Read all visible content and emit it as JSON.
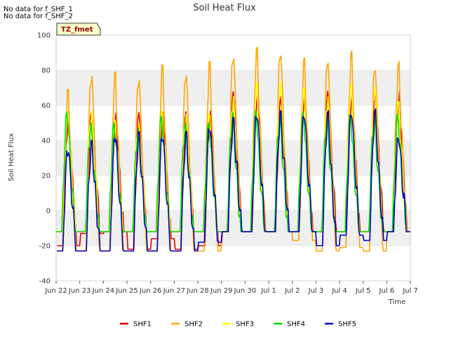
{
  "notes": [
    "No data for f_SHF_1",
    "No data for f_SHF_2"
  ],
  "badge": "TZ_fmet",
  "chart_data": {
    "type": "line",
    "title": "Soil Heat Flux",
    "xlabel": "Time",
    "ylabel": "Soil Heat Flux",
    "ylim": [
      -40,
      100
    ],
    "xlim": [
      0,
      15
    ],
    "x_ticks": [
      {
        "x": 0,
        "label": "Jun 22"
      },
      {
        "x": 1,
        "label": "Jun 23"
      },
      {
        "x": 2,
        "label": "Jun 24"
      },
      {
        "x": 3,
        "label": "Jun 25"
      },
      {
        "x": 4,
        "label": "Jun 26"
      },
      {
        "x": 5,
        "label": "Jun 27"
      },
      {
        "x": 6,
        "label": "Jun 28"
      },
      {
        "x": 7,
        "label": "Jun 29"
      },
      {
        "x": 8,
        "label": "Jun 30"
      },
      {
        "x": 9,
        "label": "Jul 1"
      },
      {
        "x": 10,
        "label": "Jul 2"
      },
      {
        "x": 11,
        "label": "Jul 3"
      },
      {
        "x": 12,
        "label": "Jul 4"
      },
      {
        "x": 13,
        "label": "Jul 5"
      },
      {
        "x": 14,
        "label": "Jul 6"
      },
      {
        "x": 15,
        "label": "Jul 7"
      }
    ],
    "y_ticks": [
      -40,
      -20,
      0,
      20,
      40,
      60,
      80,
      100
    ],
    "grid": true,
    "legend_position": "bottom",
    "days": [
      "Jun 22",
      "Jun 23",
      "Jun 24",
      "Jun 25",
      "Jun 26",
      "Jun 27",
      "Jun 28",
      "Jun 29",
      "Jun 30",
      "Jul 1",
      "Jul 2",
      "Jul 3",
      "Jul 4",
      "Jul 5",
      "Jul 6"
    ],
    "series": [
      {
        "name": "SHF1",
        "color": "#dd0000",
        "daily_peak": [
          57,
          57,
          56,
          57,
          56,
          57,
          57,
          68,
          68,
          65,
          68,
          68,
          68,
          68,
          68
        ],
        "daily_min": [
          -20,
          -13,
          -12,
          -22,
          -16,
          -22,
          -20,
          -12,
          -12,
          -12,
          -12,
          -12,
          -12,
          -12,
          -12
        ]
      },
      {
        "name": "SHF2",
        "color": "#ffa500",
        "daily_peak": [
          69,
          80,
          79,
          78,
          83,
          81,
          85,
          91,
          93,
          93,
          87,
          89,
          91,
          85,
          85
        ],
        "daily_min": [
          -23,
          -23,
          -23,
          -23,
          -23,
          -23,
          -23,
          -12,
          -12,
          -12,
          -17,
          -23,
          -21,
          -23,
          -12
        ]
      },
      {
        "name": "SHF3",
        "color": "#ffff00",
        "daily_peak": [
          57,
          57,
          52,
          50,
          57,
          55,
          55,
          65,
          73,
          73,
          70,
          65,
          72,
          72,
          62
        ],
        "daily_min": [
          -12,
          -12,
          -12,
          -12,
          -12,
          -12,
          -12,
          -12,
          -12,
          -12,
          -12,
          -12,
          -12,
          -12,
          -12
        ]
      },
      {
        "name": "SHF4",
        "color": "#00dd00",
        "daily_peak": [
          57,
          50,
          50,
          47,
          54,
          50,
          50,
          56,
          57,
          56,
          56,
          55,
          55,
          55,
          55
        ],
        "daily_min": [
          -12,
          -12,
          -12,
          -12,
          -12,
          -12,
          -12,
          -12,
          -12,
          -12,
          -12,
          -12,
          -12,
          -12,
          -12
        ]
      },
      {
        "name": "SHF5",
        "color": "#0000cc",
        "daily_peak": [
          37,
          40,
          45,
          45,
          45,
          45,
          50,
          53,
          57,
          57,
          57,
          57,
          58,
          58,
          43
        ],
        "daily_min": [
          -23,
          -23,
          -23,
          -23,
          -23,
          -23,
          -18,
          -12,
          -12,
          -12,
          -12,
          -20,
          -14,
          -17,
          -12
        ]
      }
    ]
  }
}
